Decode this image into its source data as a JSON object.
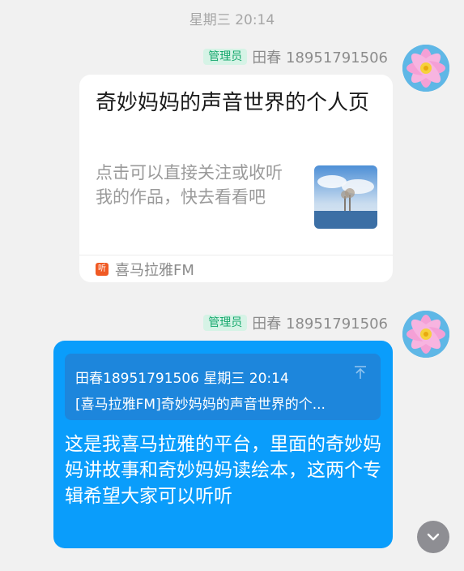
{
  "timestamp": "星期三 20:14",
  "messages": [
    {
      "badge": "管理员",
      "sender": "田春 18951791506",
      "card": {
        "title": "奇妙妈妈的声音世界的个人页",
        "description": "点击可以直接关注或收听我的作品，快去看看吧",
        "source_icon_text": "听",
        "source": "喜马拉雅FM"
      }
    },
    {
      "badge": "管理员",
      "sender": "田春 18951791506",
      "quote": {
        "header": "田春18951791506 星期三 20:14",
        "body": "[喜马拉雅FM]奇妙妈妈的声音世界的个..."
      },
      "text": "这是我喜马拉雅的平台，里面的奇妙妈妈讲故事和奇妙妈妈读绘本，这两个专辑希望大家可以听听"
    }
  ],
  "colors": {
    "background": "#f1f1f1",
    "bubble": "#0a9dfb",
    "badge_bg": "#d6f3e6",
    "badge_fg": "#16a86d"
  },
  "icons": {
    "avatar": "flower-avatar",
    "source": "ximalaya-logo-icon",
    "quote_jump": "arrow-up-to-top-icon",
    "scroll": "chevron-down-icon"
  }
}
